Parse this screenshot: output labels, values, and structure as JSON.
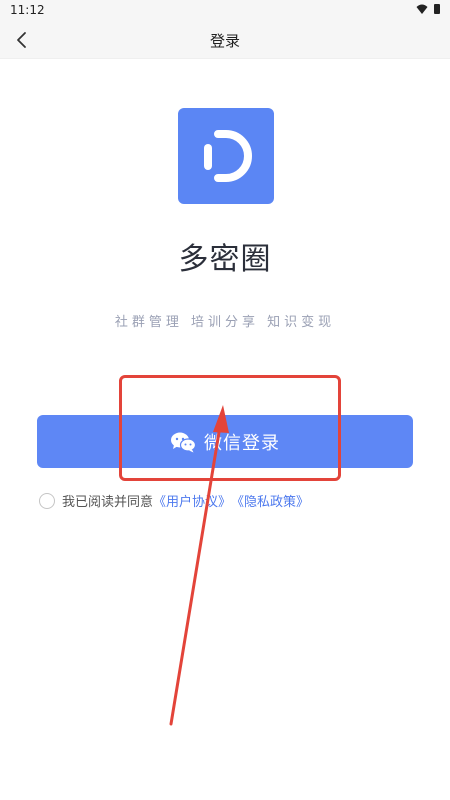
{
  "status": {
    "time": "11:12"
  },
  "appbar": {
    "title": "登录"
  },
  "app": {
    "name": "多密圈",
    "slogan": "社群管理 培训分享 知识变现"
  },
  "login": {
    "wechat_label": "微信登录"
  },
  "agreement": {
    "text": "我已阅读并同意",
    "user_agreement": "《用户协议》",
    "privacy_policy": "《隐私政策》"
  },
  "colors": {
    "brand": "#5b86f4",
    "button": "#5e87f5",
    "link": "#4d79ee",
    "annotation": "#e3443a"
  },
  "icons": {
    "back": "chevron-left-icon",
    "wifi": "wifi-icon",
    "battery": "battery-icon",
    "logo": "app-logo-d-icon",
    "wechat": "wechat-icon"
  }
}
